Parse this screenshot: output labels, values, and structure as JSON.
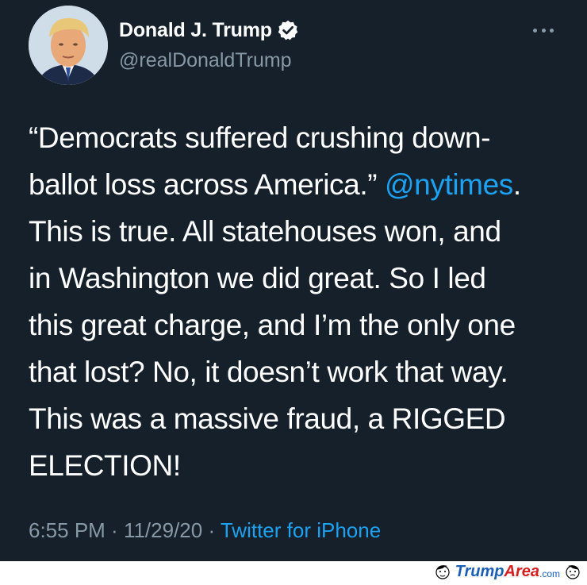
{
  "user": {
    "display_name": "Donald J. Trump",
    "handle": "@realDonaldTrump",
    "verified": true,
    "avatar_icon": "profile-photo"
  },
  "more_icon": "more-options-icon",
  "tweet": {
    "lines": [
      {
        "text": "“Democrats suffered crushing down-"
      },
      {
        "text": "ballot loss across America.” ",
        "mention": "@nytimes",
        "after": "."
      },
      {
        "text": "This is true. All statehouses won, and"
      },
      {
        "text": "in Washington we did great. So I led"
      },
      {
        "text": "this great charge, and I’m the only one"
      },
      {
        "text": "that lost? No, it doesn’t work that way."
      },
      {
        "text": "This was a massive fraud, a RIGGED"
      },
      {
        "text": "ELECTION!"
      }
    ]
  },
  "meta": {
    "time": "6:55 PM",
    "separator": " · ",
    "date": "11/29/20",
    "source": "Twitter for iPhone"
  },
  "watermark": {
    "part1": "Trump",
    "part2": "Area",
    "part3": ".com"
  },
  "colors": {
    "background": "#15202b",
    "primary_text": "#ffffff",
    "secondary_text": "#8899a6",
    "link": "#1da1f2"
  }
}
